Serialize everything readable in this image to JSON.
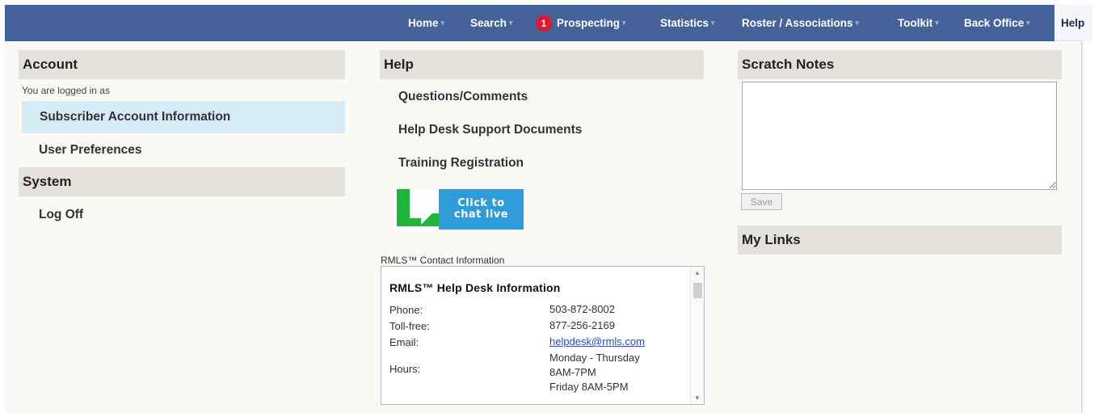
{
  "nav": {
    "items": [
      {
        "label": "Home"
      },
      {
        "label": "Search"
      },
      {
        "label": "Prospecting",
        "badge": "1"
      },
      {
        "label": "Statistics"
      },
      {
        "label": "Roster / Associations"
      },
      {
        "label": "Toolkit"
      },
      {
        "label": "Back Office"
      },
      {
        "label": "Help"
      }
    ],
    "caret": "▾"
  },
  "account": {
    "header": "Account",
    "logged_in_text": "You are logged in as",
    "items": [
      "Subscriber Account Information",
      "User Preferences"
    ]
  },
  "system": {
    "header": "System",
    "items": [
      "Log Off"
    ]
  },
  "help": {
    "header": "Help",
    "links": [
      "Questions/Comments",
      "Help Desk Support Documents",
      "Training Registration"
    ],
    "chat_button": {
      "line1": "Click to",
      "line2": "chat live"
    },
    "contact_label": "RMLS™ Contact Information",
    "contact": {
      "title": "RMLS™ Help Desk Information",
      "phone_label": "Phone:",
      "phone": "503-872-8002",
      "tollfree_label": "Toll-free:",
      "tollfree": "877-256-2169",
      "email_label": "Email:",
      "email": "helpdesk@rmls.com",
      "hours_label": "Hours:",
      "hours_line1": "Monday - Thursday",
      "hours_line2": "8AM-7PM",
      "hours_line3": "Friday 8AM-5PM"
    }
  },
  "scratch": {
    "header": "Scratch Notes",
    "notes_value": "",
    "save_label": "Save"
  },
  "links": {
    "header": "My Links"
  },
  "colors": {
    "nav_bg": "#46629b",
    "badge": "#e0182d",
    "selected_row": "#d5ecf6",
    "section_header": "#e3e1d9",
    "chat_blue": "#2f9bd8",
    "chat_green": "#1eb53a"
  }
}
